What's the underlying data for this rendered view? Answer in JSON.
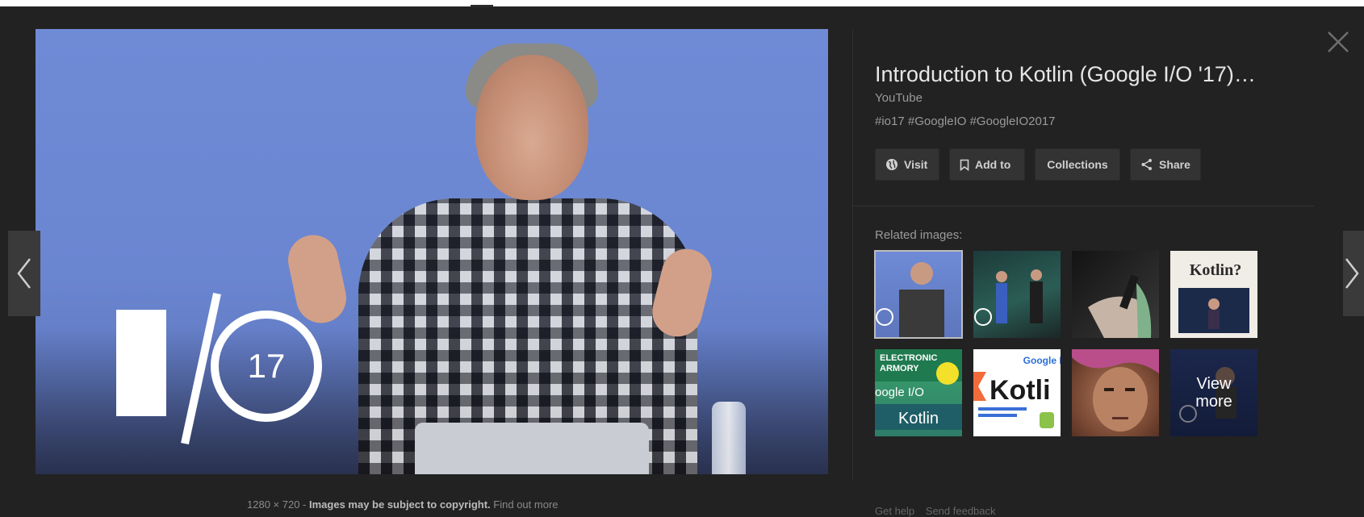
{
  "viewer": {
    "title": "Introduction to Kotlin (Google I/O '17)…",
    "source": "YouTube",
    "tags": "#io17 #GoogleIO #GoogleIO2017",
    "actions": {
      "visit": "Visit",
      "add_to": "Add to",
      "collections": "Collections",
      "share": "Share"
    },
    "related_label": "Related images:",
    "related": [
      {
        "name": "related-thumb-1"
      },
      {
        "name": "related-thumb-2"
      },
      {
        "name": "related-thumb-3"
      },
      {
        "name": "related-thumb-4",
        "text": "Kotlin?"
      },
      {
        "name": "related-thumb-5",
        "text_lines": [
          "ELECTRONIC",
          "ARMORY",
          "oogle I/O",
          "Kotlin"
        ]
      },
      {
        "name": "related-thumb-6",
        "text_lines": [
          "Google I/O",
          "Kotli"
        ]
      },
      {
        "name": "related-thumb-7"
      },
      {
        "name": "related-thumb-8",
        "view_more": [
          "View",
          "more"
        ]
      }
    ],
    "main_image": {
      "logo_number": "17"
    }
  },
  "footer": {
    "dimensions": "1280 × 720",
    "separator": " - ",
    "copyright": "Images may be subject to copyright.",
    "find_out_more": "Find out more",
    "get_help": "Get help",
    "send_feedback": "Send feedback"
  },
  "colors": {
    "background": "#222222",
    "button_bg": "#333333",
    "title_text": "#e6e6e6",
    "muted_text": "#9a9a9a"
  }
}
